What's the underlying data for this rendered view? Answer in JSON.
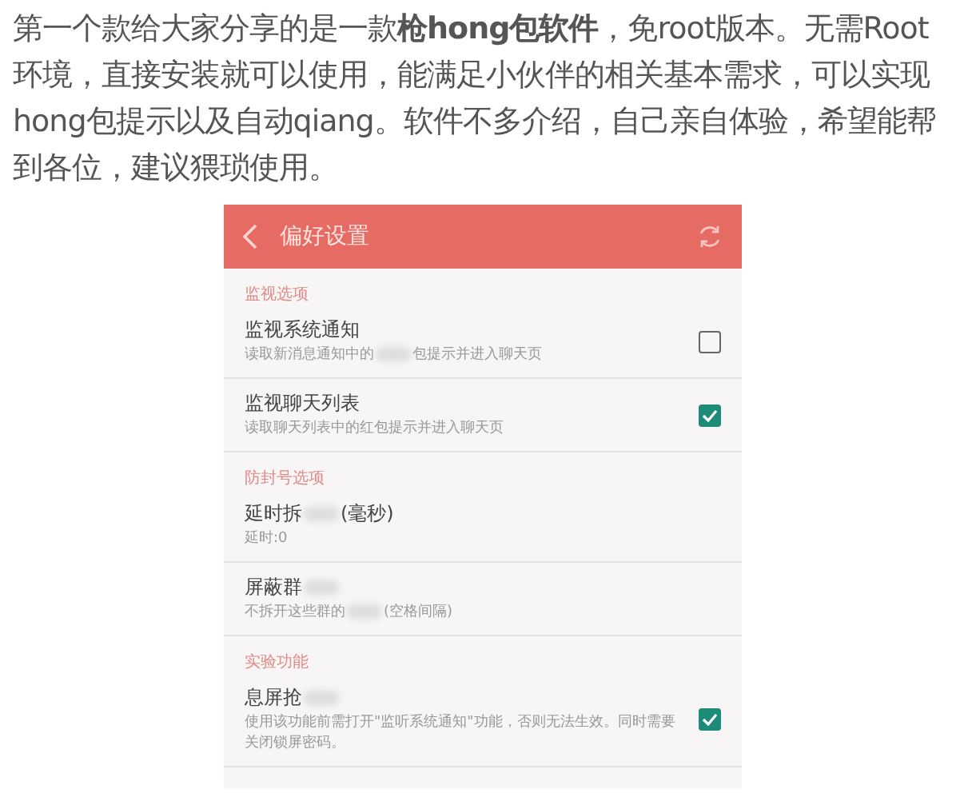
{
  "article": {
    "paragraph": "第一个款给大家分享的是一款**枪hong包软件**，免root版本。无需Root环境，直接安装就可以使用，能满足小伙伴的相关基本需求，可以实现hong包提示以及自动qiang。软件不多介绍，自己亲自体验，希望能帮到各位，建议猥琐使用。"
  },
  "app": {
    "title": "偏好设置",
    "sections": [
      {
        "heading": "监视选项",
        "items": [
          {
            "kind": "checkbox",
            "checked": false,
            "title": [
              "监视系统通知"
            ],
            "subtitle": [
              "读取新消息通知中的",
              "包提示并进入聊天页"
            ]
          },
          {
            "kind": "checkbox",
            "checked": true,
            "title": [
              "监视聊天列表"
            ],
            "subtitle": [
              "读取聊天列表中的红包提示并进入聊天页"
            ]
          }
        ]
      },
      {
        "heading": "防封号选项",
        "items": [
          {
            "kind": "plain",
            "title": [
              "延时拆",
              "(毫秒)"
            ],
            "subtitle": [
              "延时:0"
            ]
          },
          {
            "kind": "plain",
            "title": [
              "屏蔽群"
            ],
            "title_blur_tail": true,
            "subtitle": [
              "不拆开这些群的",
              "(空格间隔)"
            ]
          }
        ]
      },
      {
        "heading": "实验功能",
        "items": [
          {
            "kind": "checkbox",
            "checked": true,
            "title": [
              "息屏抢"
            ],
            "title_blur_tail": true,
            "subtitle": [
              "使用该功能前需打开\"监听系统通知\"功能，否则无法生效。同时需要关闭锁屏密码。"
            ]
          }
        ]
      }
    ]
  }
}
